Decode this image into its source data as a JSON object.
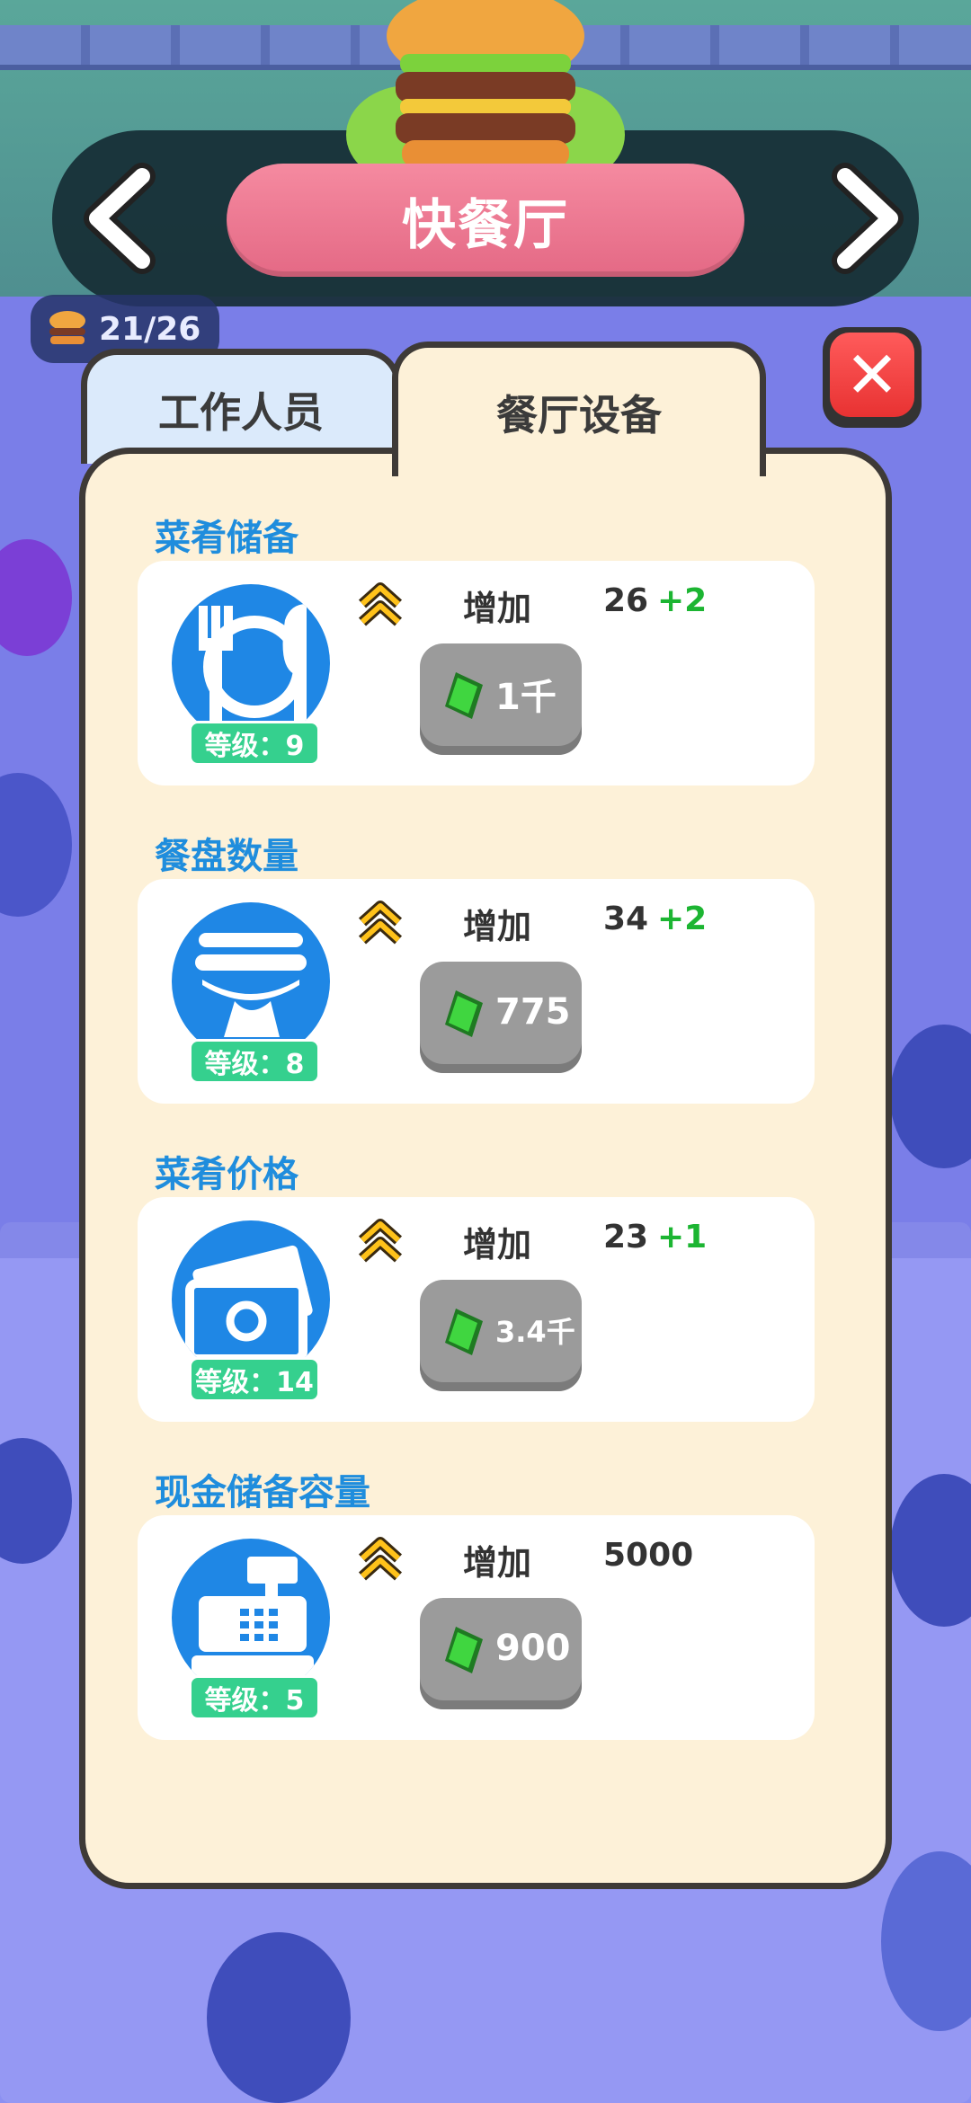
{
  "header": {
    "title": "快餐厅"
  },
  "hud": {
    "burger_count": "21/26"
  },
  "tabs": {
    "staff": "工作人员",
    "equipment": "餐厅设备"
  },
  "upgrades": [
    {
      "title": "菜肴储备",
      "level": "等级：9",
      "increase_label": "增加",
      "value": "26",
      "bonus": "+2",
      "price": "1千",
      "icon": "plate-cutlery-icon"
    },
    {
      "title": "餐盘数量",
      "level": "等级：8",
      "increase_label": "增加",
      "value": "34",
      "bonus": "+2",
      "price": "775",
      "icon": "tray-stack-icon"
    },
    {
      "title": "菜肴价格",
      "level": "等级：14",
      "increase_label": "增加",
      "value": "23",
      "bonus": "+1",
      "price": "3.4千",
      "icon": "cash-bill-icon"
    },
    {
      "title": "现金储备容量",
      "level": "等级：5",
      "increase_label": "增加",
      "value": "5000",
      "bonus": "",
      "price": "900",
      "icon": "cash-register-icon"
    }
  ],
  "colors": {
    "accent_blue": "#1f87e5",
    "title_pink": "#e46985",
    "bonus_green": "#1cb532",
    "level_green": "#35d08e",
    "close_red": "#e83232"
  }
}
